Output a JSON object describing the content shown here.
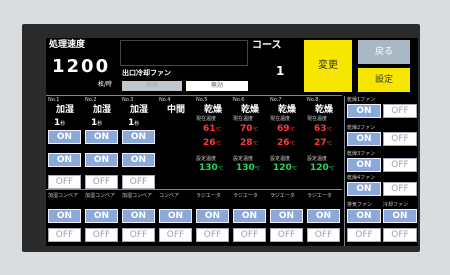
{
  "speed": {
    "label": "処理速度",
    "value": "1200",
    "unit": "枚/時"
  },
  "fan_title": "出口冷却ファン",
  "fan_toggle": {
    "on": "有効",
    "off": "無効"
  },
  "course": {
    "label": "コース",
    "value": "1"
  },
  "buttons": {
    "change": "変更",
    "return": "戻る",
    "settings": "設定"
  },
  "zones": [
    {
      "no": "No.1",
      "name": "加湿",
      "time": "1",
      "unit": "秒"
    },
    {
      "no": "No.2",
      "name": "加湿",
      "time": "1",
      "unit": "秒"
    },
    {
      "no": "No.3",
      "name": "加湿",
      "time": "1",
      "unit": "秒"
    },
    {
      "no": "No.4",
      "name": "中間"
    },
    {
      "no": "No.5",
      "name": "乾燥",
      "cur_label": "現在温度",
      "cur1": "61",
      "cur2": "26",
      "set_label": "設定温度",
      "set": "130"
    },
    {
      "no": "No.6",
      "name": "乾燥",
      "cur_label": "現在温度",
      "cur1": "70",
      "cur2": "28",
      "set_label": "設定温度",
      "set": "130"
    },
    {
      "no": "No.7",
      "name": "乾燥",
      "cur_label": "現在温度",
      "cur1": "69",
      "cur2": "26",
      "set_label": "設定温度",
      "set": "120"
    },
    {
      "no": "No.8",
      "name": "乾燥",
      "cur_label": "現在温度",
      "cur1": "63",
      "cur2": "27",
      "set_label": "設定温度",
      "set": "120"
    }
  ],
  "degc": "℃",
  "on": "ON",
  "off": "OFF",
  "conveyor_labels": [
    "加湿コンベア",
    "加湿コンベア",
    "加湿コンベア",
    "コンベア",
    "ラジエータ",
    "ラジエータ",
    "ラジエータ",
    "ラジエータ"
  ],
  "right_labels": [
    "乾燥1ファン",
    "乾燥2ファン",
    "乾燥3ファン",
    "乾燥4ファン",
    "排気ファン",
    "冷却ファン"
  ]
}
